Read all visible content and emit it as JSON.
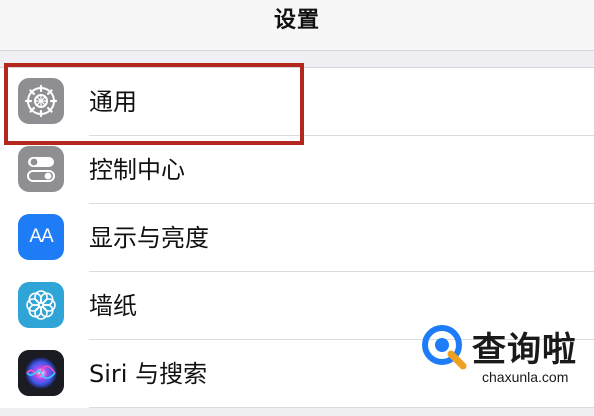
{
  "navbar": {
    "title": "设置"
  },
  "settings": {
    "items": [
      {
        "label": "通用",
        "icon": "gear-icon",
        "color": "#8e8e93"
      },
      {
        "label": "控制中心",
        "icon": "toggle-switches-icon",
        "color": "#8e8e93"
      },
      {
        "label": "显示与亮度",
        "icon": "text-size-aa-icon",
        "color": "#1e7cf6",
        "glyph": "AA"
      },
      {
        "label": "墙纸",
        "icon": "flower-icon",
        "color": "#2fa4d6"
      },
      {
        "label": "Siri 与搜索",
        "icon": "siri-icon",
        "color": "#111111"
      }
    ]
  },
  "highlight": {
    "color": "#b3271c",
    "target": "通用"
  },
  "watermark": {
    "text": "查询啦",
    "subtext": "chaxunla.com",
    "logo": "q-search-logo",
    "color": "#1e7cf6"
  }
}
